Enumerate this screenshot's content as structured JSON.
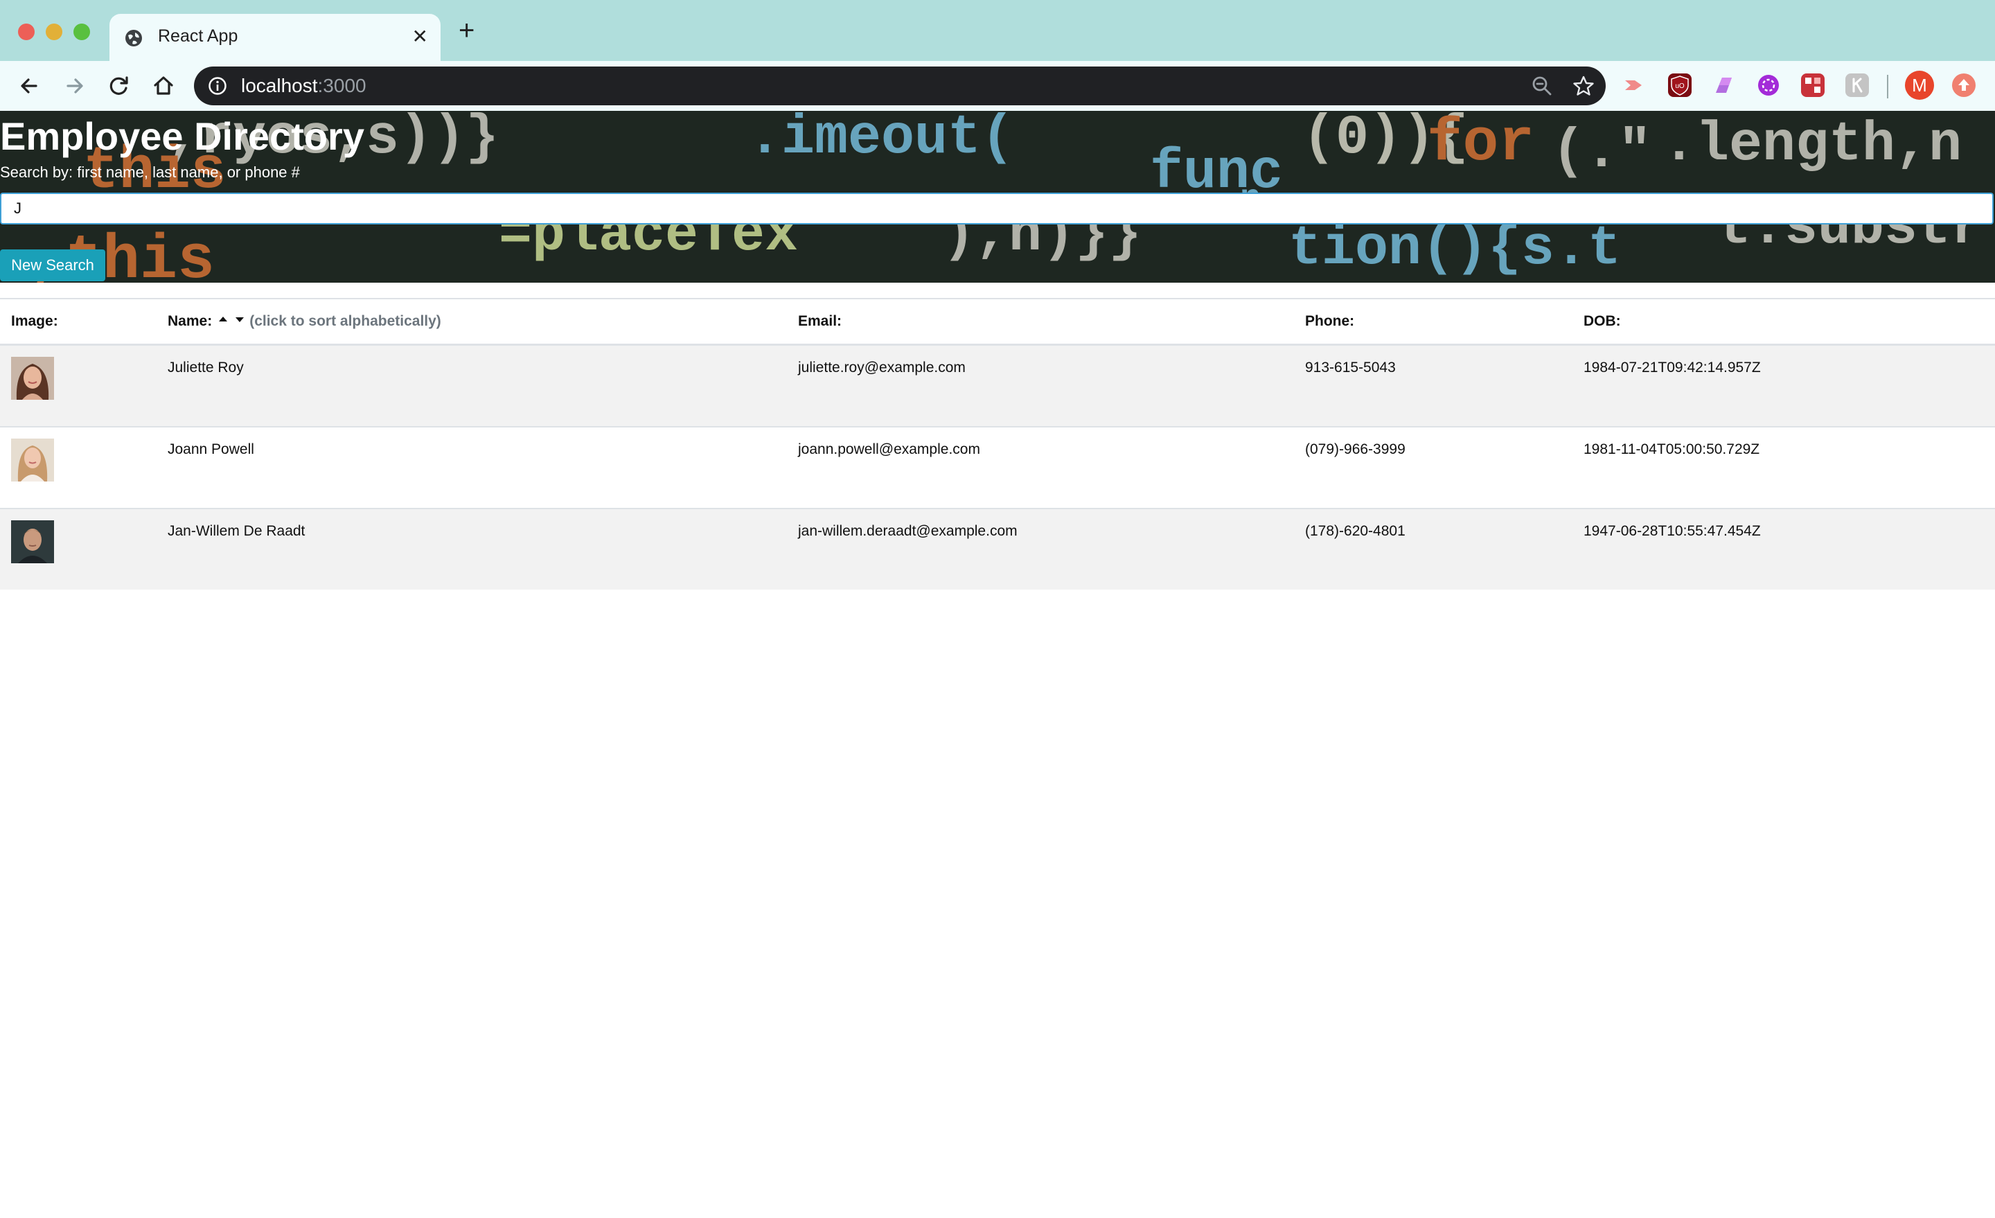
{
  "browser": {
    "tab_title": "React App",
    "url_host": "localhost",
    "url_port": ":3000",
    "profile_initial": "M",
    "icons": [
      "globe-icon",
      "close-tab-icon",
      "new-tab-icon",
      "back-icon",
      "forward-icon",
      "reload-icon",
      "home-icon",
      "info-icon",
      "zoom-icon",
      "bookmark-star-icon"
    ],
    "extensions": [
      "ext-red-arrow-icon",
      "ublock-icon",
      "ext-purple-icon",
      "ext-violet-icon",
      "ext-red-icon",
      "ext-gray-icon",
      "ext-orange-icon"
    ]
  },
  "header": {
    "title": "Employee Directory",
    "search_hint": "Search by: first name, last name, or phone #",
    "search_value": "J",
    "button_label": "New Search"
  },
  "table": {
    "headers": {
      "image": "Image:",
      "name": "Name:",
      "sort_hint": "(click to sort alphabetically)",
      "email": "Email:",
      "phone": "Phone:",
      "dob": "DOB:"
    },
    "rows": [
      {
        "name": "Juliette Roy",
        "email": "juliette.roy@example.com",
        "phone": "913-615-5043",
        "dob": "1984-07-21T09:42:14.957Z"
      },
      {
        "name": "Joann Powell",
        "email": "joann.powell@example.com",
        "phone": "(079)-966-3999",
        "dob": "1981-11-04T05:00:50.729Z"
      },
      {
        "name": "Jan-Willem De Raadt",
        "email": "jan-willem.deraadt@example.com",
        "phone": "(178)-620-4801",
        "dob": "1947-06-28T10:55:47.454Z"
      }
    ]
  },
  "colors": {
    "chrome_frame": "#b0dedc",
    "omnibox": "#202124",
    "button": "#1aa0b8",
    "stripe": "#f2f2f2",
    "input_focus": "#3fa0d6"
  }
}
